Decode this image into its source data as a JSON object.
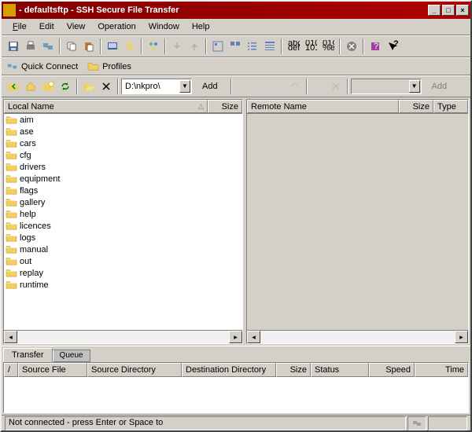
{
  "window": {
    "title": " - defaultsftp - SSH Secure File Transfer"
  },
  "menubar": {
    "file": "File",
    "edit": "Edit",
    "view": "View",
    "operation": "Operation",
    "window": "Window",
    "help": "Help"
  },
  "connectbar": {
    "quick_connect": "Quick Connect",
    "profiles": "Profiles"
  },
  "local_nav": {
    "path": "D:\\nkpro\\",
    "add_label": "Add"
  },
  "remote_nav": {
    "path": "",
    "add_label": "Add"
  },
  "local_pane": {
    "columns": {
      "name": "Local Name",
      "size": "Size"
    },
    "items": [
      {
        "name": "aim"
      },
      {
        "name": "ase"
      },
      {
        "name": "cars"
      },
      {
        "name": "cfg"
      },
      {
        "name": "drivers"
      },
      {
        "name": "equipment"
      },
      {
        "name": "flags"
      },
      {
        "name": "gallery"
      },
      {
        "name": "help"
      },
      {
        "name": "licences"
      },
      {
        "name": "logs"
      },
      {
        "name": "manual"
      },
      {
        "name": "out"
      },
      {
        "name": "replay"
      },
      {
        "name": "runtime"
      }
    ]
  },
  "remote_pane": {
    "columns": {
      "name": "Remote Name",
      "size": "Size",
      "type": "Type"
    },
    "items": []
  },
  "tabs": {
    "transfer": "Transfer",
    "queue": "Queue"
  },
  "transfer_cols": {
    "spacer": "/",
    "source_file": "Source File",
    "source_dir": "Source Directory",
    "dest_dir": "Destination Directory",
    "size": "Size",
    "status": "Status",
    "speed": "Speed",
    "time": "Time"
  },
  "statusbar": {
    "text": "Not connected - press Enter or Space to"
  }
}
